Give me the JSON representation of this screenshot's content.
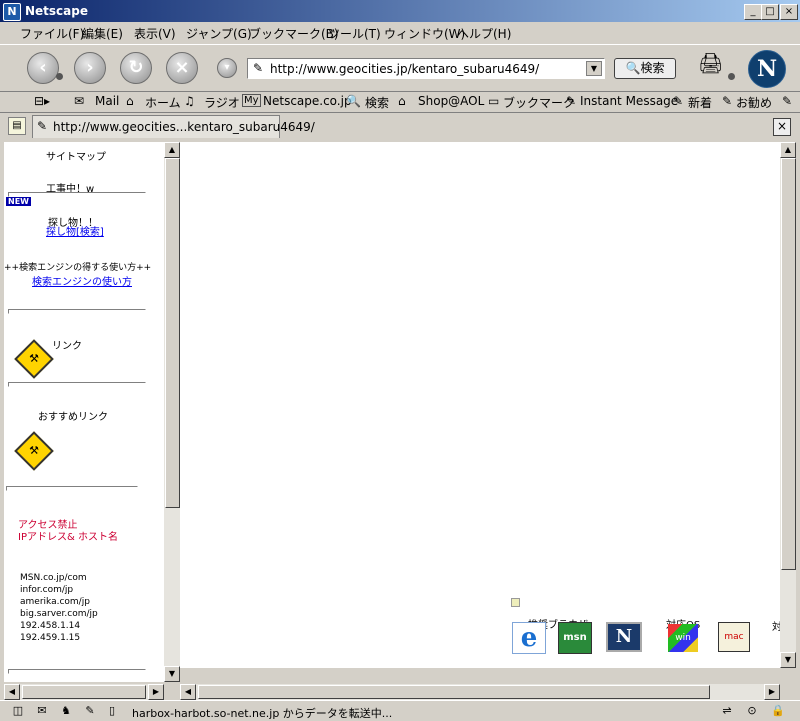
{
  "window": {
    "title": "Netscape",
    "minimize": "_",
    "maximize": "□",
    "close": "×"
  },
  "menu": [
    {
      "label": "ファイル(F)"
    },
    {
      "label": "編集(E)"
    },
    {
      "label": "表示(V)"
    },
    {
      "label": "ジャンプ(G)"
    },
    {
      "label": "ブックマーク(B)"
    },
    {
      "label": "ツール(T)"
    },
    {
      "label": "ウィンドウ(W)"
    },
    {
      "label": "ヘルプ(H)"
    }
  ],
  "nav": {
    "url": "http://www.geocities.jp/kentaro_subaru4649/",
    "search_label": "検索",
    "logo": "N"
  },
  "personal": [
    {
      "label": "Mail"
    },
    {
      "label": "ホーム"
    },
    {
      "label": "ラジオ"
    },
    {
      "label": "Netscape.co.jp"
    },
    {
      "label": "検索"
    },
    {
      "label": "Shop@AOL"
    },
    {
      "label": "ブックマーク"
    },
    {
      "label": "Instant Message"
    },
    {
      "label": "新着"
    },
    {
      "label": "お勧め"
    }
  ],
  "tab": {
    "title": "http://www.geocities...kentaro_subaru4649/",
    "close": "×"
  },
  "left": {
    "sitemap": "サイトマップ",
    "wip": "工事中！w",
    "new_badge": "NEW",
    "search_title": "探し物！！",
    "search_link": "探し物[検索]",
    "engine_title": "++検索エンジンの得する使い方++",
    "engine_link": "検索エンジンの使い方",
    "links": "リンク",
    "recommended": "おすすめリンク",
    "block_title": "アクセス禁止",
    "block_subtitle": "IPアドレス& ホスト名",
    "hosts": [
      "MSN.co.jp/com",
      "infor.com/jp",
      "amerika.com/jp",
      "big.sarver.com/jp",
      "192.458.1.14",
      "192.459.1.15"
    ]
  },
  "right": {
    "browser_label": "推奨ブラウザ",
    "os_label": "対応OS",
    "os_label2": "対",
    "badges": [
      "e",
      "msn",
      "N",
      "win",
      "mac"
    ]
  },
  "status": {
    "text": "harbox-harbot.so-net.ne.jp からデータを転送中..."
  }
}
